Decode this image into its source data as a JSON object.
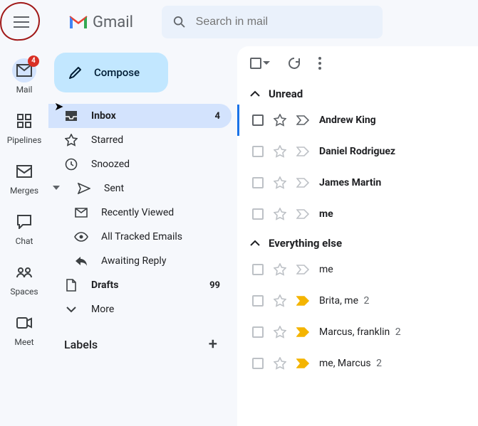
{
  "header": {
    "app_name": "Gmail",
    "search_placeholder": "Search in mail"
  },
  "rail": [
    {
      "name": "mail",
      "label": "Mail",
      "badge": "4",
      "active": true
    },
    {
      "name": "pipelines",
      "label": "Pipelines",
      "badge": null,
      "active": false
    },
    {
      "name": "merges",
      "label": "Merges",
      "badge": null,
      "active": false
    },
    {
      "name": "chat",
      "label": "Chat",
      "badge": null,
      "active": false
    },
    {
      "name": "spaces",
      "label": "Spaces",
      "badge": null,
      "active": false
    },
    {
      "name": "meet",
      "label": "Meet",
      "badge": null,
      "active": false
    }
  ],
  "sidebar": {
    "compose_label": "Compose",
    "items": [
      {
        "name": "inbox",
        "label": "Inbox",
        "count": "4",
        "active": true,
        "sub": false,
        "expand": null,
        "bold": true
      },
      {
        "name": "starred",
        "label": "Starred",
        "count": null,
        "active": false,
        "sub": false,
        "expand": null,
        "bold": false
      },
      {
        "name": "snoozed",
        "label": "Snoozed",
        "count": null,
        "active": false,
        "sub": false,
        "expand": null,
        "bold": false
      },
      {
        "name": "sent",
        "label": "Sent",
        "count": null,
        "active": false,
        "sub": false,
        "expand": "open",
        "bold": false
      },
      {
        "name": "recently-viewed",
        "label": "Recently Viewed",
        "count": null,
        "active": false,
        "sub": true,
        "expand": null,
        "bold": false
      },
      {
        "name": "tracked-emails",
        "label": "All Tracked Emails",
        "count": null,
        "active": false,
        "sub": true,
        "expand": null,
        "bold": false
      },
      {
        "name": "awaiting-reply",
        "label": "Awaiting Reply",
        "count": null,
        "active": false,
        "sub": true,
        "expand": null,
        "bold": false
      },
      {
        "name": "drafts",
        "label": "Drafts",
        "count": "99",
        "active": false,
        "sub": false,
        "expand": null,
        "bold": true
      },
      {
        "name": "more",
        "label": "More",
        "count": null,
        "active": false,
        "sub": false,
        "expand": "closed",
        "bold": false
      }
    ],
    "labels_header": "Labels"
  },
  "inbox": {
    "sections": [
      {
        "title": "Unread",
        "unread": true,
        "rows": [
          {
            "sender": "Andrew King",
            "count": null,
            "flag": false,
            "first": true
          },
          {
            "sender": "Daniel Rodriguez",
            "count": null,
            "flag": false,
            "first": false
          },
          {
            "sender": "James Martin",
            "count": null,
            "flag": false,
            "first": false
          },
          {
            "sender": "me",
            "count": null,
            "flag": false,
            "first": false
          }
        ]
      },
      {
        "title": "Everything else",
        "unread": false,
        "rows": [
          {
            "sender": "me",
            "count": null,
            "flag": false,
            "first": false
          },
          {
            "sender": "Brita, me",
            "count": "2",
            "flag": true,
            "first": false
          },
          {
            "sender": "Marcus, franklin",
            "count": "2",
            "flag": true,
            "first": false
          },
          {
            "sender": "me, Marcus",
            "count": "2",
            "flag": true,
            "first": false
          }
        ]
      }
    ]
  }
}
